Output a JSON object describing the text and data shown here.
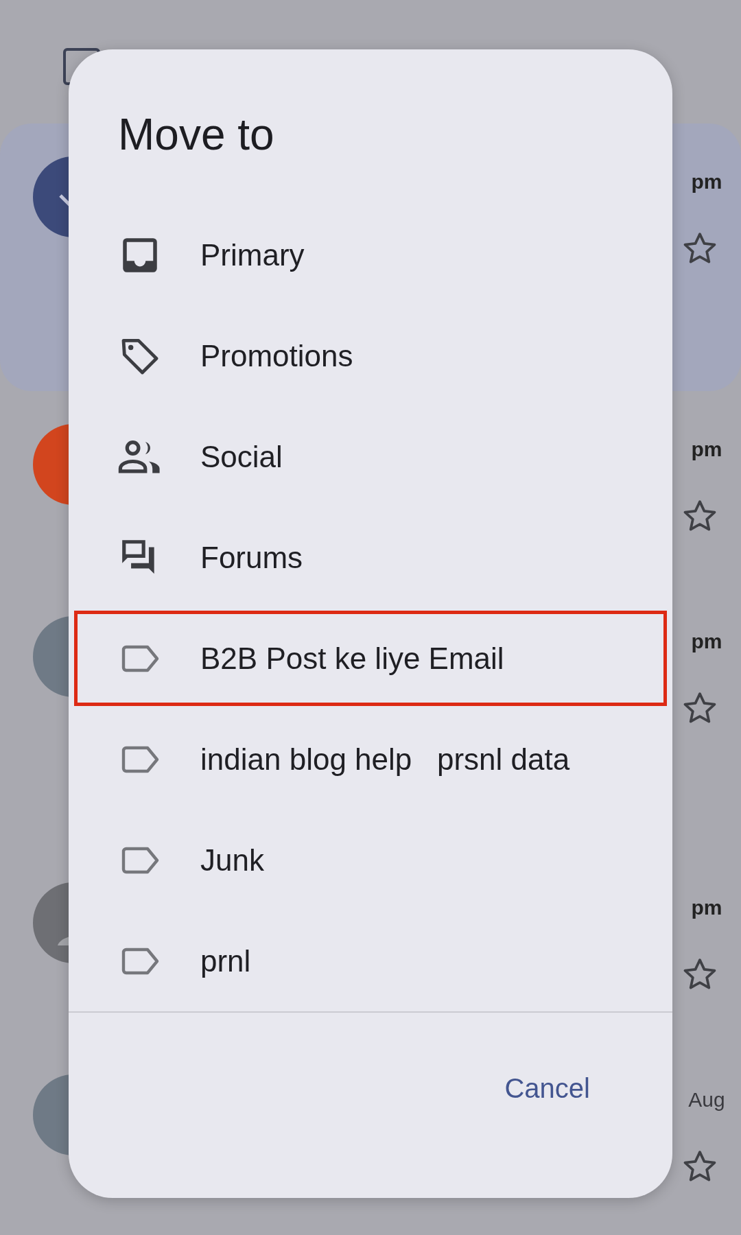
{
  "inbox_behind": {
    "select_all_checked": false,
    "emails": [
      {
        "time": "pm",
        "selected": true,
        "kind": "check",
        "color": "#3c4a7a"
      },
      {
        "time": "pm",
        "selected": false,
        "kind": "mascot",
        "color": "#d2451e"
      },
      {
        "time": "pm",
        "selected": false,
        "kind": "plain",
        "color": "#6f7a86"
      },
      {
        "time": "pm",
        "selected": false,
        "kind": "person",
        "color": "#6e6f74"
      },
      {
        "time": "Aug",
        "selected": false,
        "kind": "plain",
        "color": "#6f7a86"
      }
    ]
  },
  "dialog": {
    "title": "Move to",
    "items": [
      {
        "label": "Primary",
        "kind": "inbox",
        "highlighted": false
      },
      {
        "label": "Promotions",
        "kind": "tag",
        "highlighted": false
      },
      {
        "label": "Social",
        "kind": "people",
        "highlighted": false
      },
      {
        "label": "Forums",
        "kind": "forum",
        "highlighted": false
      },
      {
        "label": "B2B Post ke liye Email",
        "kind": "label",
        "highlighted": true
      },
      {
        "label": "indian blog help   prsnl data",
        "kind": "label",
        "highlighted": false
      },
      {
        "label": "Junk",
        "kind": "label",
        "highlighted": false
      },
      {
        "label": "prnl",
        "kind": "label",
        "highlighted": false
      }
    ],
    "cancel": "Cancel"
  }
}
